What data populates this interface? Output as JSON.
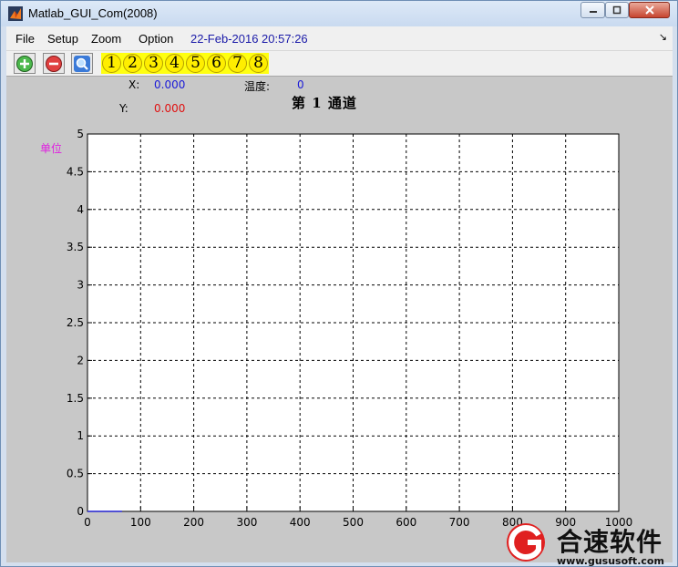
{
  "window": {
    "title": "Matlab_GUI_Com(2008)"
  },
  "menu": {
    "items": [
      "File",
      "Setup",
      "Zoom",
      "Option"
    ],
    "datetime": "22-Feb-2016 20:57:26"
  },
  "toolbar": {
    "buttons": [
      {
        "icon": "zoom-in-icon"
      },
      {
        "icon": "zoom-out-icon"
      },
      {
        "icon": "magnifier-icon"
      }
    ],
    "channels": [
      "1",
      "2",
      "3",
      "4",
      "5",
      "6",
      "7",
      "8"
    ]
  },
  "readout": {
    "x_label": "X:",
    "x_value": "0.000",
    "y_label": "Y:",
    "y_value": "0.000",
    "temp_label": "温度:",
    "temp_value": "0"
  },
  "chart_data": {
    "type": "line",
    "title": "第 1 通道",
    "ylabel": "单位",
    "xlabel": "",
    "xlim": [
      0,
      1000
    ],
    "ylim": [
      0,
      5
    ],
    "x_ticks": [
      0,
      100,
      200,
      300,
      400,
      500,
      600,
      700,
      800,
      900,
      1000
    ],
    "y_ticks": [
      0,
      0.5,
      1,
      1.5,
      2,
      2.5,
      3,
      3.5,
      4,
      4.5,
      5
    ],
    "grid": true,
    "series": [
      {
        "x": [
          0,
          65
        ],
        "y": [
          0,
          0
        ],
        "color": "#2020d0"
      }
    ]
  },
  "watermark": {
    "text": "合速软件",
    "url": "www.gususoft.com"
  },
  "colors": {
    "blue_value": "#1a1ad8",
    "red_value": "#e01010",
    "unit": "#e020e0",
    "channel_yellow": "#ffee00"
  }
}
